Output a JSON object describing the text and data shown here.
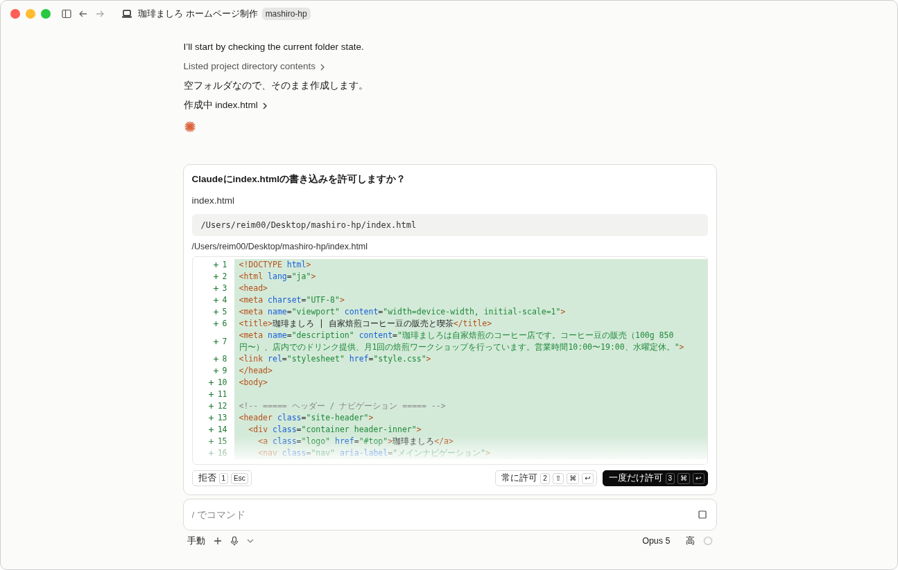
{
  "window": {
    "title": "珈琲ましろ ホームページ制作",
    "project_badge": "mashiro-hp"
  },
  "messages": [
    {
      "kind": "text",
      "text": "I’ll start by checking the current folder state."
    },
    {
      "kind": "tool",
      "text": "Listed project directory contents"
    },
    {
      "kind": "text",
      "text": "空フォルダなので、そのまま作成します。"
    },
    {
      "kind": "tool_active",
      "text": "作成中 index.html"
    }
  ],
  "permission": {
    "question": "Claudeにindex.htmlの書き込みを許可しますか？",
    "file_name": "index.html",
    "path_box": "/Users/reim00/Desktop/mashiro-hp/index.html",
    "path_label": "/Users/reim00/Desktop/mashiro-hp/index.html",
    "code_lines": [
      {
        "number": "1",
        "tokens": [
          {
            "kind": "tag",
            "text": "<!DOCTYPE "
          },
          {
            "kind": "attr",
            "text": "html"
          },
          {
            "kind": "tag",
            "text": ">"
          }
        ]
      },
      {
        "number": "2",
        "tokens": [
          {
            "kind": "tag",
            "text": "<html "
          },
          {
            "kind": "attr",
            "text": "lang"
          },
          {
            "kind": "plain",
            "text": "="
          },
          {
            "kind": "str",
            "text": "\"ja\""
          },
          {
            "kind": "tag",
            "text": ">"
          }
        ]
      },
      {
        "number": "3",
        "tokens": [
          {
            "kind": "tag",
            "text": "<head>"
          }
        ]
      },
      {
        "number": "4",
        "tokens": [
          {
            "kind": "tag",
            "text": "<meta "
          },
          {
            "kind": "attr",
            "text": "charset"
          },
          {
            "kind": "plain",
            "text": "="
          },
          {
            "kind": "str",
            "text": "\"UTF-8\""
          },
          {
            "kind": "tag",
            "text": ">"
          }
        ]
      },
      {
        "number": "5",
        "tokens": [
          {
            "kind": "tag",
            "text": "<meta "
          },
          {
            "kind": "attr",
            "text": "name"
          },
          {
            "kind": "plain",
            "text": "="
          },
          {
            "kind": "str",
            "text": "\"viewport\" "
          },
          {
            "kind": "attr",
            "text": "content"
          },
          {
            "kind": "plain",
            "text": "="
          },
          {
            "kind": "str",
            "text": "\"width=device-width, initial-scale=1\""
          },
          {
            "kind": "tag",
            "text": ">"
          }
        ]
      },
      {
        "number": "6",
        "tokens": [
          {
            "kind": "tag",
            "text": "<title>"
          },
          {
            "kind": "plain",
            "text": "珈琲ましろ | 自家焙煎コーヒー豆の販売と喫茶"
          },
          {
            "kind": "tag",
            "text": "</title>"
          }
        ]
      },
      {
        "number": "7",
        "tokens": [
          {
            "kind": "tag",
            "text": "<meta "
          },
          {
            "kind": "attr",
            "text": "name"
          },
          {
            "kind": "plain",
            "text": "="
          },
          {
            "kind": "str",
            "text": "\"description\" "
          },
          {
            "kind": "attr",
            "text": "content"
          },
          {
            "kind": "plain",
            "text": "="
          },
          {
            "kind": "str",
            "text": "\"珈琲ましろは自家焙煎のコーヒー店です。コーヒー豆の販売（100g 850円〜）、店内でのドリンク提供、月1回の焙煎ワークショップを行っています。営業時間10:00〜19:00、水曜定休。\""
          },
          {
            "kind": "tag",
            "text": ">"
          }
        ]
      },
      {
        "number": "8",
        "tokens": [
          {
            "kind": "tag",
            "text": "<link "
          },
          {
            "kind": "attr",
            "text": "rel"
          },
          {
            "kind": "plain",
            "text": "="
          },
          {
            "kind": "str",
            "text": "\"stylesheet\" "
          },
          {
            "kind": "attr",
            "text": "href"
          },
          {
            "kind": "plain",
            "text": "="
          },
          {
            "kind": "str",
            "text": "\"style.css\""
          },
          {
            "kind": "tag",
            "text": ">"
          }
        ]
      },
      {
        "number": "9",
        "tokens": [
          {
            "kind": "tag",
            "text": "</head>"
          }
        ]
      },
      {
        "number": "10",
        "tokens": [
          {
            "kind": "tag",
            "text": "<body>"
          }
        ]
      },
      {
        "number": "11"
      },
      {
        "number": "12",
        "tokens": [
          {
            "kind": "comment",
            "text": "<!-- ===== ヘッダー / ナビゲーション ===== -->"
          }
        ]
      },
      {
        "number": "13",
        "tokens": [
          {
            "kind": "tag",
            "text": "<header "
          },
          {
            "kind": "attr",
            "text": "class"
          },
          {
            "kind": "plain",
            "text": "="
          },
          {
            "kind": "str",
            "text": "\"site-header\""
          },
          {
            "kind": "tag",
            "text": ">"
          }
        ]
      },
      {
        "number": "14",
        "tokens": [
          {
            "kind": "tag",
            "text": "  <div "
          },
          {
            "kind": "attr",
            "text": "class"
          },
          {
            "kind": "plain",
            "text": "="
          },
          {
            "kind": "str",
            "text": "\"container header-inner\""
          },
          {
            "kind": "tag",
            "text": ">"
          }
        ]
      },
      {
        "number": "15",
        "tokens": [
          {
            "kind": "tag",
            "text": "    <a "
          },
          {
            "kind": "attr",
            "text": "class"
          },
          {
            "kind": "plain",
            "text": "="
          },
          {
            "kind": "str",
            "text": "\"logo\" "
          },
          {
            "kind": "attr",
            "text": "href"
          },
          {
            "kind": "plain",
            "text": "="
          },
          {
            "kind": "str",
            "text": "\"#top\""
          },
          {
            "kind": "tag",
            "text": ">"
          },
          {
            "kind": "plain",
            "text": "珈琲ましろ"
          },
          {
            "kind": "tag",
            "text": "</a>"
          }
        ]
      },
      {
        "number": "16",
        "tokens": [
          {
            "kind": "tag",
            "text": "    <nav "
          },
          {
            "kind": "attr",
            "text": "class"
          },
          {
            "kind": "plain",
            "text": "="
          },
          {
            "kind": "str",
            "text": "\"nav\" "
          },
          {
            "kind": "attr",
            "text": "aria-label"
          },
          {
            "kind": "plain",
            "text": "="
          },
          {
            "kind": "str",
            "text": "\"メインナビゲーション\""
          },
          {
            "kind": "tag",
            "text": ">"
          }
        ]
      }
    ],
    "actions": [
      {
        "kind": "secondary",
        "label": "拒否",
        "number": "1",
        "keys": [
          "Esc"
        ]
      },
      {
        "kind": "spacer"
      },
      {
        "kind": "secondary",
        "label": "常に許可",
        "number": "2",
        "keys": [
          "⇧",
          "⌘",
          "↩"
        ]
      },
      {
        "kind": "primary",
        "label": "一度だけ許可",
        "number": "3",
        "keys": [
          "⌘",
          "↩"
        ]
      }
    ]
  },
  "composer": {
    "placeholder": "/ でコマンド"
  },
  "footer": {
    "mode": "手動",
    "model": "Opus 5",
    "effort": "高"
  }
}
